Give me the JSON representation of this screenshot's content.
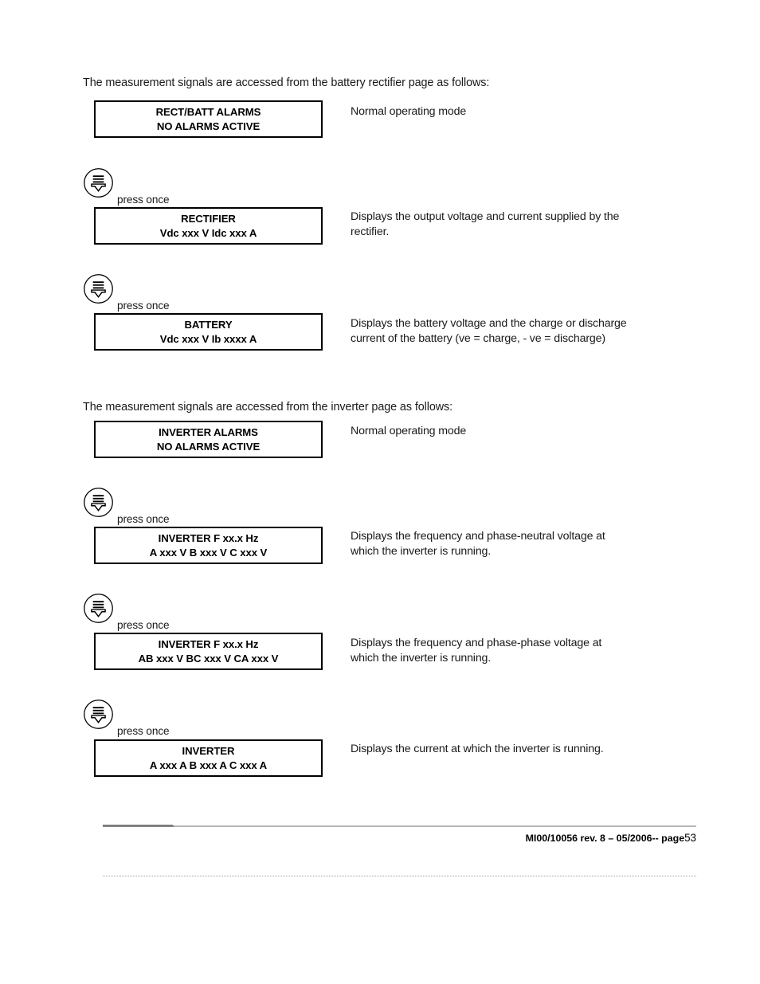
{
  "document": {
    "intro_rectifier": "The measurement signals are accessed from the battery rectifier page as follows:",
    "intro_inverter": "The measurement signals are accessed from the inverter page as follows:",
    "press_once_label": "press once",
    "key_icon_name": "press-down-key-icon"
  },
  "rectifier_section": {
    "alarm_display": {
      "line1": "RECT/BATT ALARMS",
      "line2": "NO ALARMS ACTIVE",
      "description": "Normal operating mode"
    },
    "steps": [
      {
        "press": "press once",
        "line1": "RECTIFIER",
        "line2": "Vdc xxx V Idc xxx A",
        "description": "Displays the output voltage and current supplied by the rectifier."
      },
      {
        "press": "press once",
        "line1": "BATTERY",
        "line2": "Vdc xxx V Ib xxxx A",
        "description": "Displays the battery voltage and the charge or discharge current of the battery (ve = charge, - ve = discharge)"
      }
    ]
  },
  "inverter_section": {
    "alarm_display": {
      "line1": "INVERTER ALARMS",
      "line2": "NO ALARMS ACTIVE",
      "description": "Normal operating mode"
    },
    "steps": [
      {
        "press": "press once",
        "line1": "INVERTER F xx.x Hz",
        "line2": "A xxx V  B xxx V  C xxx V",
        "description": "Displays the frequency and phase-neutral voltage at which the inverter is running."
      },
      {
        "press": "press once",
        "line1": "INVERTER F xx.x Hz",
        "line2": "AB xxx V  BC xxx V  CA xxx V",
        "description": "Displays the frequency and phase-phase voltage at which the inverter is running."
      },
      {
        "press": "press once",
        "line1": "INVERTER",
        "line2": "A xxx A  B xxx A  C xxx A",
        "description": "Displays the current at which the inverter is running."
      }
    ]
  },
  "footer": {
    "doc_ref": "MI00/10056 rev. 8 – 05/2006-- page",
    "page_number": "53"
  }
}
